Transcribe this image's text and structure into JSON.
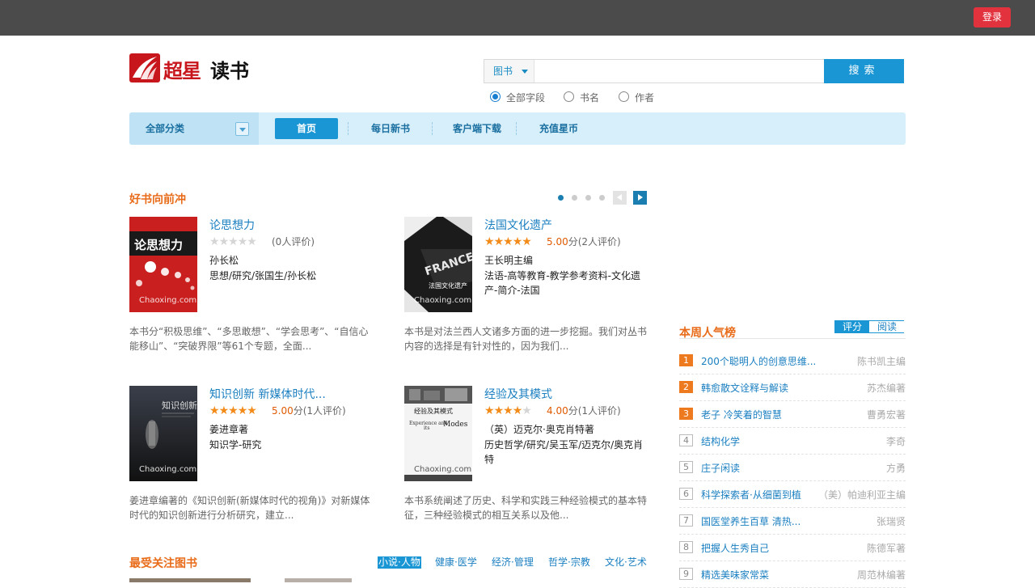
{
  "topbar": {
    "login_label": "登录"
  },
  "logo": {
    "brand_chars": "超星",
    "product": "读书"
  },
  "search": {
    "type_label": "图书",
    "placeholder": "",
    "button_label": "搜索",
    "options": [
      {
        "label": "全部字段",
        "checked": true
      },
      {
        "label": "书名",
        "checked": false
      },
      {
        "label": "作者",
        "checked": false
      }
    ]
  },
  "nav": {
    "all_categories": "全部分类",
    "items": [
      {
        "label": "首页",
        "active": true
      },
      {
        "label": "每日新书",
        "active": false
      },
      {
        "label": "客户端下载",
        "active": false
      },
      {
        "label": "充值星币",
        "active": false
      }
    ]
  },
  "featured": {
    "title": "好书向前冲",
    "books": [
      {
        "title": "论思想力",
        "stars": 0,
        "score": "",
        "score_unit": "",
        "reviews": "(0人评价)",
        "author": "孙长松",
        "tags": "思想/研究/张国生/孙长松",
        "desc": "本书分“积极思维”、“多思敢想”、“学会思考”、“自信心能移山”、“突破界限”等61个专题，全面...",
        "cover_watermark": "Chaoxing.com",
        "cover_title": "论思想力"
      },
      {
        "title": "法国文化遗产",
        "stars": 5,
        "score": "5.00",
        "score_unit": "分",
        "reviews": "(2人评价)",
        "author": "王长明主编",
        "tags": "法语-高等教育-教学参考资料-文化遗产-简介-法国",
        "desc": "本书是对法兰西人文诸多方面的进一步挖掘。我们对丛书内容的选择是有针对性的，因为我们...",
        "cover_watermark": "Chaoxing.com",
        "cover_title": "法国文化遗产"
      },
      {
        "title": "知识创新 新媒体时代...",
        "stars": 5,
        "score": "5.00",
        "score_unit": "分",
        "reviews": "(1人评价)",
        "author": "姜进章著",
        "tags": "知识学-研究",
        "desc": "姜进章编著的《知识创新(新媒体时代的视角)》对新媒体时代的知识创新进行分析研究，建立...",
        "cover_watermark": "Chaoxing.com",
        "cover_title": "知识创新"
      },
      {
        "title": "经验及其模式",
        "stars": 4,
        "score": "4.00",
        "score_unit": "分",
        "reviews": "(1人评价)",
        "author": "（英）迈克尔·奥克肖特著",
        "tags": "历史哲学/研究/吴玉军/迈克尔/奥克肖特",
        "desc": "本书系统阐述了历史、科学和实践三种经验模式的基本特征，三种经验模式的相互关系以及他...",
        "cover_watermark": "Chaoxing.com",
        "cover_title": "经验及其模式"
      }
    ]
  },
  "ranking": {
    "title": "本周人气榜",
    "tabs": [
      {
        "label": "评分",
        "active": true
      },
      {
        "label": "阅读",
        "active": false
      }
    ],
    "items": [
      {
        "rank": "1",
        "title": "200个聪明人的创意思维...",
        "author": "陈书凯主编"
      },
      {
        "rank": "2",
        "title": "韩愈散文诠释与解读",
        "author": "苏杰编著"
      },
      {
        "rank": "3",
        "title": "老子 冷笑着的智慧",
        "author": "曹勇宏著"
      },
      {
        "rank": "4",
        "title": "结构化学",
        "author": "李奇"
      },
      {
        "rank": "5",
        "title": "庄子闲读",
        "author": "方勇"
      },
      {
        "rank": "6",
        "title": "科学探索者·从细菌到植",
        "author": "（美）帕迪利亚主编"
      },
      {
        "rank": "7",
        "title": "国医堂养生百草 清热...",
        "author": "张瑞贤"
      },
      {
        "rank": "8",
        "title": "把握人生秀自己",
        "author": "陈德军著"
      },
      {
        "rank": "9",
        "title": "精选美味家常菜",
        "author": "周范林编著"
      }
    ]
  },
  "popular": {
    "title": "最受关注图书",
    "tabs": [
      {
        "label": "小说·人物",
        "active": true
      },
      {
        "label": "健康·医学",
        "active": false
      },
      {
        "label": "经济·管理",
        "active": false
      },
      {
        "label": "哲学·宗教",
        "active": false
      },
      {
        "label": "文化·艺术",
        "active": false
      }
    ]
  },
  "colors": {
    "accent_blue": "#1a96d4",
    "orange_title": "#e86c1a",
    "login_red": "#e2323d",
    "star": "#f38b1a"
  }
}
